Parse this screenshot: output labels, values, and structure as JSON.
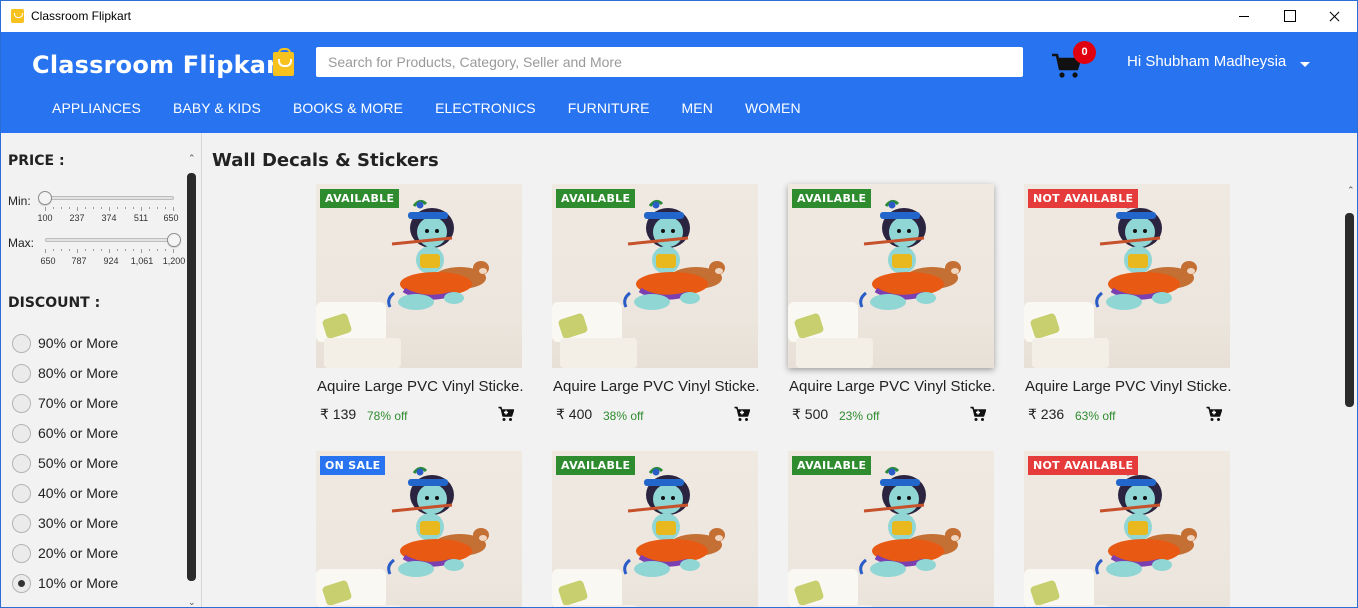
{
  "window": {
    "title": "Classroom Flipkart"
  },
  "header": {
    "brand": "Classroom Flipkart",
    "search_placeholder": "Search for Products, Category, Seller and More",
    "cart_count": "0",
    "user_greeting": "Hi Shubham Madheysia",
    "nav": [
      "APPLIANCES",
      "BABY & KIDS",
      "BOOKS & MORE",
      "ELECTRONICS",
      "FURNITURE",
      "MEN",
      "WOMEN"
    ],
    "colors": {
      "header_bg": "#2874f0",
      "badge_red": "#e0000f"
    }
  },
  "sidebar": {
    "price_heading": "PRICE :",
    "min_label": "Min:",
    "max_label": "Max:",
    "min_ticks": [
      "100",
      "237",
      "374",
      "511",
      "650"
    ],
    "max_ticks": [
      "650",
      "787",
      "924",
      "1,061",
      "1,200"
    ],
    "min_value": "100",
    "max_value": "1,200",
    "discount_heading": "DISCOUNT :",
    "discounts": [
      "90% or More",
      "80% or More",
      "70% or More",
      "60% or More",
      "50% or More",
      "40% or More",
      "30% or More",
      "20% or More",
      "10% or More"
    ],
    "selected_discount": "10% or More"
  },
  "main": {
    "section_title": "Wall Decals & Stickers",
    "products": [
      {
        "badge": "AVAILABLE",
        "badge_type": "available",
        "name": "Aquire Large PVC Vinyl Sticke...",
        "price": "₹ 139",
        "off": "78% off"
      },
      {
        "badge": "AVAILABLE",
        "badge_type": "available",
        "name": "Aquire Large PVC Vinyl Sticke...",
        "price": "₹ 400",
        "off": "38% off"
      },
      {
        "badge": "AVAILABLE",
        "badge_type": "available",
        "name": "Aquire Large PVC Vinyl Sticke...",
        "price": "₹ 500",
        "off": "23% off"
      },
      {
        "badge": "NOT AVAILABLE",
        "badge_type": "notavail",
        "name": "Aquire Large PVC Vinyl Sticke...",
        "price": "₹ 236",
        "off": "63% off"
      },
      {
        "badge": "ON SALE",
        "badge_type": "onsale"
      },
      {
        "badge": "AVAILABLE",
        "badge_type": "available"
      },
      {
        "badge": "AVAILABLE",
        "badge_type": "available"
      },
      {
        "badge": "NOT AVAILABLE",
        "badge_type": "notavail"
      }
    ]
  }
}
